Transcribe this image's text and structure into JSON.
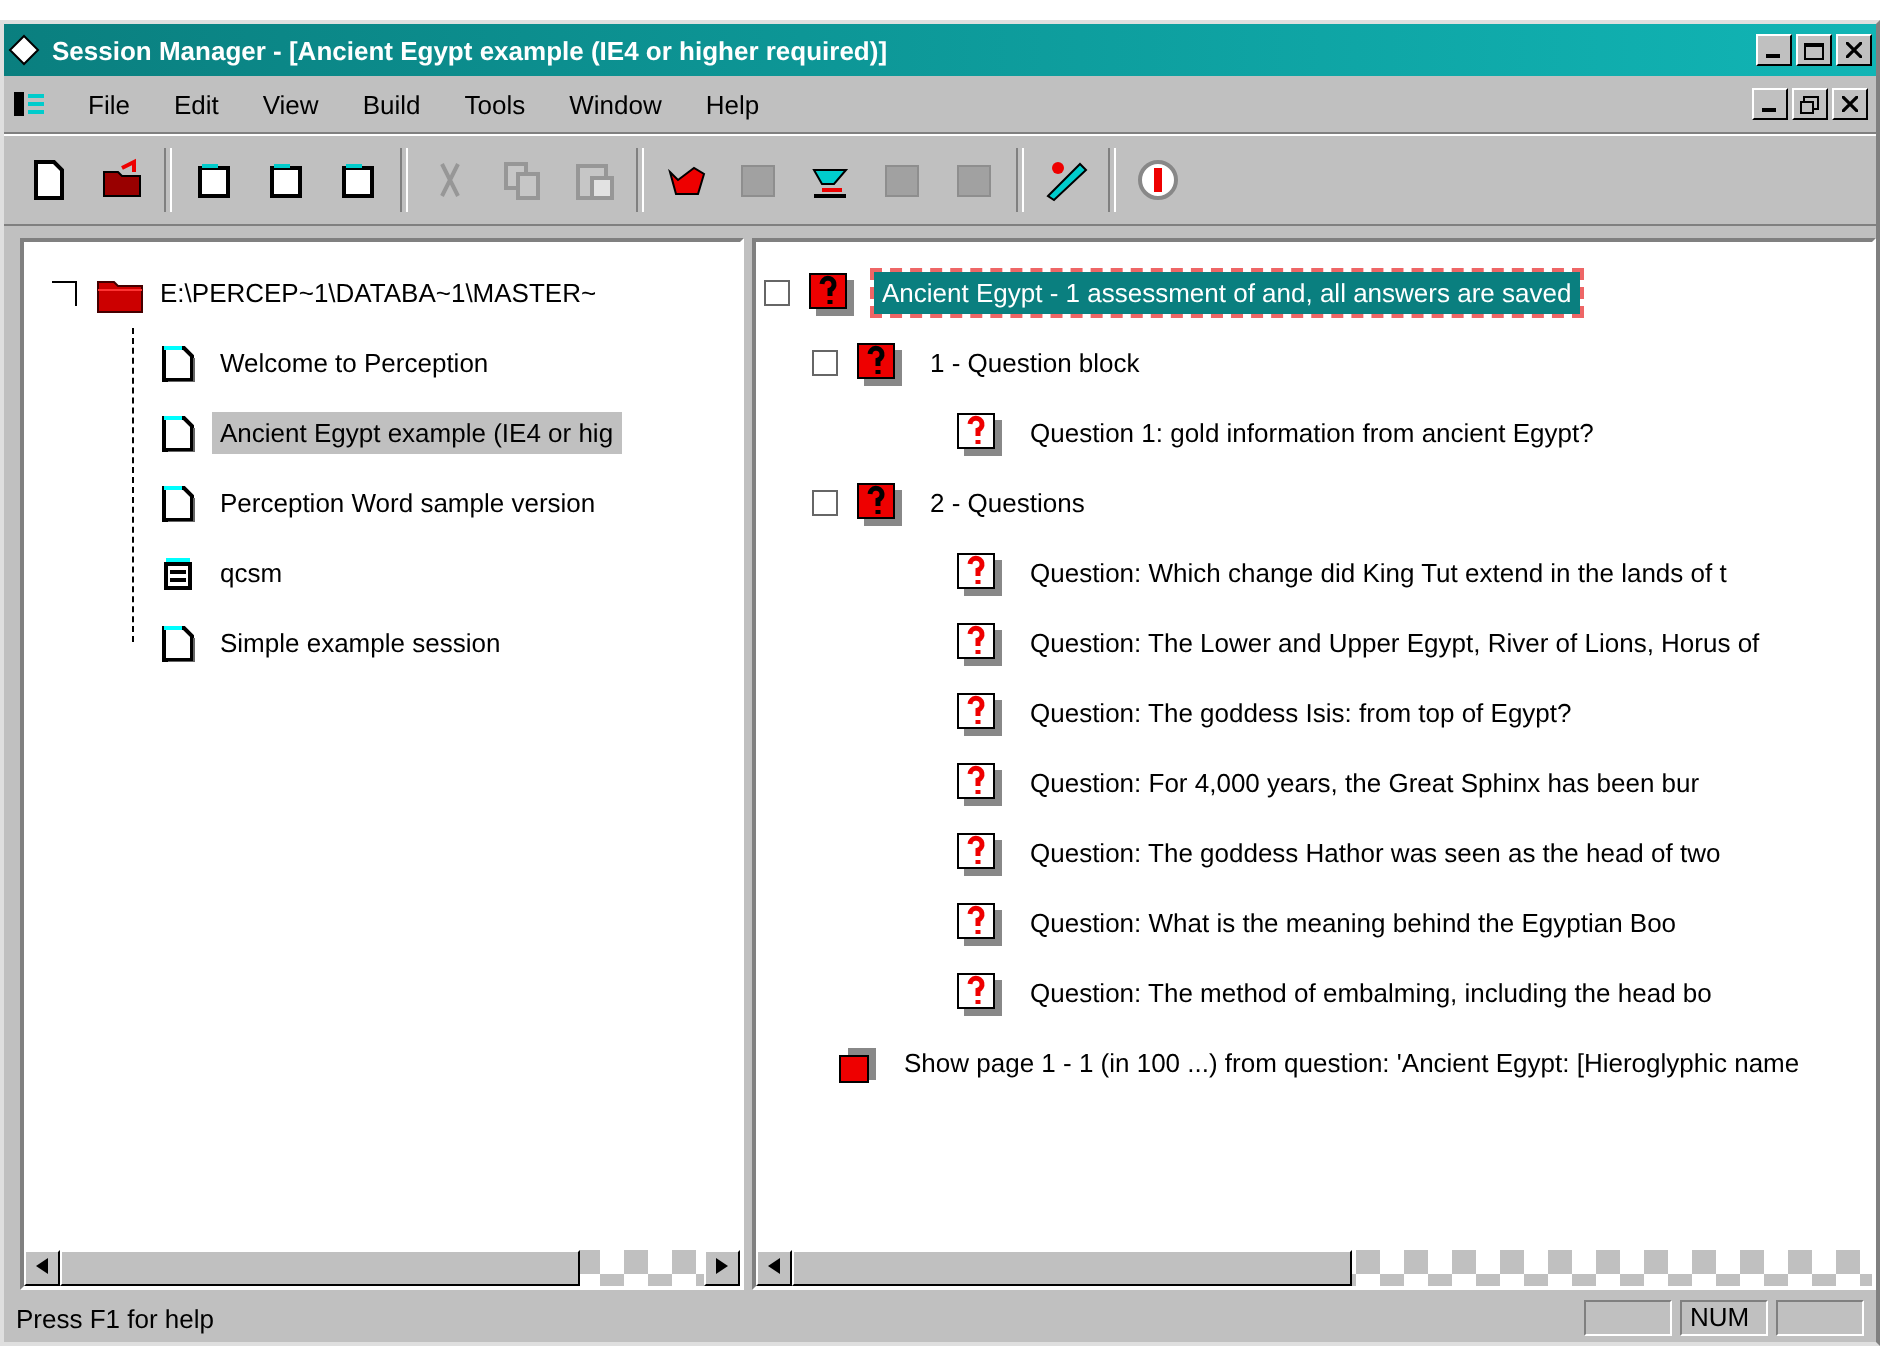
{
  "window": {
    "title": "Session Manager - [Ancient Egypt example (IE4 or higher required)]"
  },
  "menu": [
    "File",
    "Edit",
    "View",
    "Build",
    "Tools",
    "Window",
    "Help"
  ],
  "toolbar": [
    {
      "kind": "new",
      "disabled": false
    },
    {
      "kind": "open",
      "disabled": false
    },
    {
      "kind": "sep"
    },
    {
      "kind": "doc",
      "disabled": false
    },
    {
      "kind": "doc",
      "disabled": false
    },
    {
      "kind": "doc",
      "disabled": false
    },
    {
      "kind": "sep"
    },
    {
      "kind": "cut",
      "disabled": true
    },
    {
      "kind": "copy",
      "disabled": true
    },
    {
      "kind": "paste",
      "disabled": true
    },
    {
      "kind": "sep"
    },
    {
      "kind": "red",
      "disabled": false
    },
    {
      "kind": "grey",
      "disabled": true
    },
    {
      "kind": "cyan",
      "disabled": false
    },
    {
      "kind": "grey",
      "disabled": true
    },
    {
      "kind": "grey",
      "disabled": true
    },
    {
      "kind": "sep"
    },
    {
      "kind": "edit",
      "disabled": false
    },
    {
      "kind": "sep"
    },
    {
      "kind": "stop",
      "disabled": false
    }
  ],
  "tree": {
    "label": "E:\\PERCEP~1\\DATABA~1\\MASTER~",
    "children": [
      {
        "label": "Welcome to Perception",
        "kind": "doc",
        "selected": false
      },
      {
        "label": "Ancient Egypt example (IE4 or hig",
        "kind": "doc",
        "selected": true
      },
      {
        "label": "Perception Word sample version",
        "kind": "doc",
        "selected": false
      },
      {
        "label": "qcsm",
        "kind": "list",
        "selected": false
      },
      {
        "label": "Simple example session",
        "kind": "doc",
        "selected": false
      }
    ]
  },
  "outline": [
    {
      "kind": "session",
      "label": "Ancient Egypt - 1 assessment of and, all answers are saved",
      "selected": true,
      "checked": false,
      "children": [
        {
          "kind": "block",
          "label": "1 - Question block",
          "selected": false,
          "checked": false,
          "children": [
            {
              "kind": "question",
              "label": "Question 1: gold information from ancient Egypt?"
            }
          ]
        },
        {
          "kind": "block",
          "label": "2 - Questions",
          "selected": false,
          "checked": false,
          "children": [
            {
              "kind": "question",
              "label": "Question: Which change did King Tut extend in the lands of t"
            },
            {
              "kind": "question",
              "label": "Question: The Lower and Upper Egypt, River of Lions, Horus of"
            },
            {
              "kind": "question",
              "label": "Question: The goddess Isis: from top of Egypt?"
            },
            {
              "kind": "question",
              "label": "Question: For 4,000 years, the Great Sphinx has been bur"
            },
            {
              "kind": "question",
              "label": "Question: The goddess Hathor was seen as the head of two"
            },
            {
              "kind": "question",
              "label": "Question: What is the meaning behind the Egyptian Boo"
            },
            {
              "kind": "question",
              "label": "Question: The method of embalming, including the head bo"
            }
          ]
        }
      ]
    },
    {
      "kind": "page",
      "label": "Show page 1 - 1 (in 100 ...) from question: 'Ancient Egypt: [Hieroglyphic name"
    }
  ],
  "status_bar": {
    "text": "Press F1 for help",
    "indicator": "NUM"
  }
}
